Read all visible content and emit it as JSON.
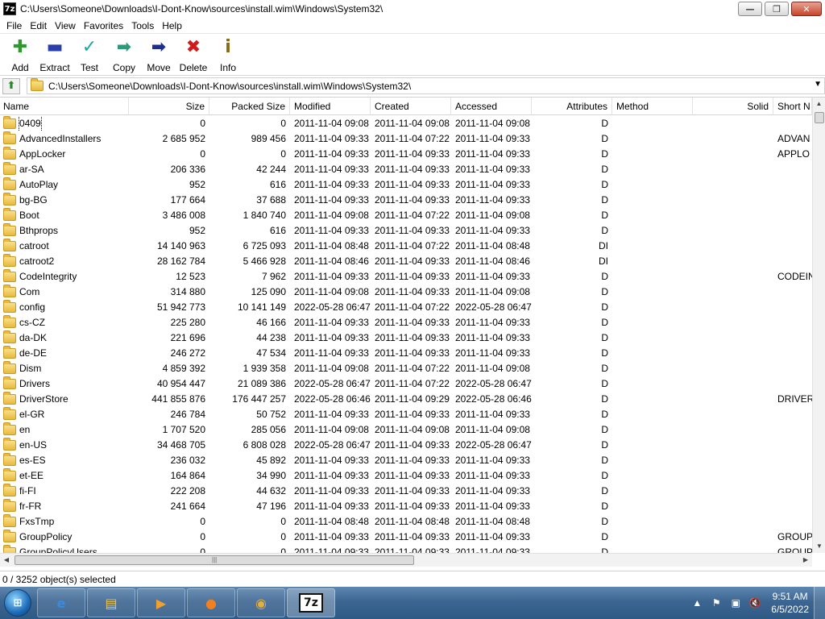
{
  "window": {
    "app_icon": "7z",
    "title": "C:\\Users\\Someone\\Downloads\\I-Dont-Know\\sources\\install.wim\\Windows\\System32\\",
    "min_label": "—",
    "max_label": "❐",
    "close_label": "✕"
  },
  "menu": [
    "File",
    "Edit",
    "View",
    "Favorites",
    "Tools",
    "Help"
  ],
  "toolbar": [
    {
      "label": "Add",
      "icon": "add-icon",
      "glyph": "✚",
      "color": "#2e9a2e"
    },
    {
      "label": "Extract",
      "icon": "extract-icon",
      "glyph": "▬",
      "color": "#2a3fa8"
    },
    {
      "label": "Test",
      "icon": "test-icon",
      "glyph": "✓",
      "color": "#1fa3a3"
    },
    {
      "label": "Copy",
      "icon": "copy-icon",
      "glyph": "➡",
      "color": "#2e9a7a"
    },
    {
      "label": "Move",
      "icon": "move-icon",
      "glyph": "➡",
      "color": "#1f2f8a"
    },
    {
      "label": "Delete",
      "icon": "delete-icon",
      "glyph": "✖",
      "color": "#d11a1a"
    },
    {
      "label": "Info",
      "icon": "info-icon",
      "glyph": "i",
      "color": "#8a6a10"
    }
  ],
  "address": {
    "up_glyph": "⬆",
    "path": "C:\\Users\\Someone\\Downloads\\I-Dont-Know\\sources\\install.wim\\Windows\\System32\\",
    "dropdown": "▼"
  },
  "columns": [
    "Name",
    "Size",
    "Packed Size",
    "Modified",
    "Created",
    "Accessed",
    "Attributes",
    "Method",
    "Solid",
    "Short N"
  ],
  "rows": [
    {
      "name": "0409",
      "size": "0",
      "packed": "0",
      "modified": "2011-11-04 09:08",
      "created": "2011-11-04 09:08",
      "accessed": "2011-11-04 09:08",
      "attr": "D",
      "short": "",
      "selected": true
    },
    {
      "name": "AdvancedInstallers",
      "size": "2 685 952",
      "packed": "989 456",
      "modified": "2011-11-04 09:33",
      "created": "2011-11-04 07:22",
      "accessed": "2011-11-04 09:33",
      "attr": "D",
      "short": "ADVAN"
    },
    {
      "name": "AppLocker",
      "size": "0",
      "packed": "0",
      "modified": "2011-11-04 09:33",
      "created": "2011-11-04 09:33",
      "accessed": "2011-11-04 09:33",
      "attr": "D",
      "short": "APPLO"
    },
    {
      "name": "ar-SA",
      "size": "206 336",
      "packed": "42 244",
      "modified": "2011-11-04 09:33",
      "created": "2011-11-04 09:33",
      "accessed": "2011-11-04 09:33",
      "attr": "D",
      "short": ""
    },
    {
      "name": "AutoPlay",
      "size": "952",
      "packed": "616",
      "modified": "2011-11-04 09:33",
      "created": "2011-11-04 09:33",
      "accessed": "2011-11-04 09:33",
      "attr": "D",
      "short": ""
    },
    {
      "name": "bg-BG",
      "size": "177 664",
      "packed": "37 688",
      "modified": "2011-11-04 09:33",
      "created": "2011-11-04 09:33",
      "accessed": "2011-11-04 09:33",
      "attr": "D",
      "short": ""
    },
    {
      "name": "Boot",
      "size": "3 486 008",
      "packed": "1 840 740",
      "modified": "2011-11-04 09:08",
      "created": "2011-11-04 07:22",
      "accessed": "2011-11-04 09:08",
      "attr": "D",
      "short": ""
    },
    {
      "name": "Bthprops",
      "size": "952",
      "packed": "616",
      "modified": "2011-11-04 09:33",
      "created": "2011-11-04 09:33",
      "accessed": "2011-11-04 09:33",
      "attr": "D",
      "short": ""
    },
    {
      "name": "catroot",
      "size": "14 140 963",
      "packed": "6 725 093",
      "modified": "2011-11-04 08:48",
      "created": "2011-11-04 07:22",
      "accessed": "2011-11-04 08:48",
      "attr": "DI",
      "short": ""
    },
    {
      "name": "catroot2",
      "size": "28 162 784",
      "packed": "5 466 928",
      "modified": "2011-11-04 08:46",
      "created": "2011-11-04 09:33",
      "accessed": "2011-11-04 08:46",
      "attr": "DI",
      "short": ""
    },
    {
      "name": "CodeIntegrity",
      "size": "12 523",
      "packed": "7 962",
      "modified": "2011-11-04 09:33",
      "created": "2011-11-04 09:33",
      "accessed": "2011-11-04 09:33",
      "attr": "D",
      "short": "CODEIN"
    },
    {
      "name": "Com",
      "size": "314 880",
      "packed": "125 090",
      "modified": "2011-11-04 09:08",
      "created": "2011-11-04 09:33",
      "accessed": "2011-11-04 09:08",
      "attr": "D",
      "short": ""
    },
    {
      "name": "config",
      "size": "51 942 773",
      "packed": "10 141 149",
      "modified": "2022-05-28 06:47",
      "created": "2011-11-04 07:22",
      "accessed": "2022-05-28 06:47",
      "attr": "D",
      "short": ""
    },
    {
      "name": "cs-CZ",
      "size": "225 280",
      "packed": "46 166",
      "modified": "2011-11-04 09:33",
      "created": "2011-11-04 09:33",
      "accessed": "2011-11-04 09:33",
      "attr": "D",
      "short": ""
    },
    {
      "name": "da-DK",
      "size": "221 696",
      "packed": "44 238",
      "modified": "2011-11-04 09:33",
      "created": "2011-11-04 09:33",
      "accessed": "2011-11-04 09:33",
      "attr": "D",
      "short": ""
    },
    {
      "name": "de-DE",
      "size": "246 272",
      "packed": "47 534",
      "modified": "2011-11-04 09:33",
      "created": "2011-11-04 09:33",
      "accessed": "2011-11-04 09:33",
      "attr": "D",
      "short": ""
    },
    {
      "name": "Dism",
      "size": "4 859 392",
      "packed": "1 939 358",
      "modified": "2011-11-04 09:08",
      "created": "2011-11-04 07:22",
      "accessed": "2011-11-04 09:08",
      "attr": "D",
      "short": ""
    },
    {
      "name": "Drivers",
      "size": "40 954 447",
      "packed": "21 089 386",
      "modified": "2022-05-28 06:47",
      "created": "2011-11-04 07:22",
      "accessed": "2022-05-28 06:47",
      "attr": "D",
      "short": ""
    },
    {
      "name": "DriverStore",
      "size": "441 855 876",
      "packed": "176 447 257",
      "modified": "2022-05-28 06:46",
      "created": "2011-11-04 09:29",
      "accessed": "2022-05-28 06:46",
      "attr": "D",
      "short": "DRIVER"
    },
    {
      "name": "el-GR",
      "size": "246 784",
      "packed": "50 752",
      "modified": "2011-11-04 09:33",
      "created": "2011-11-04 09:33",
      "accessed": "2011-11-04 09:33",
      "attr": "D",
      "short": ""
    },
    {
      "name": "en",
      "size": "1 707 520",
      "packed": "285 056",
      "modified": "2011-11-04 09:08",
      "created": "2011-11-04 09:08",
      "accessed": "2011-11-04 09:08",
      "attr": "D",
      "short": ""
    },
    {
      "name": "en-US",
      "size": "34 468 705",
      "packed": "6 808 028",
      "modified": "2022-05-28 06:47",
      "created": "2011-11-04 09:33",
      "accessed": "2022-05-28 06:47",
      "attr": "D",
      "short": ""
    },
    {
      "name": "es-ES",
      "size": "236 032",
      "packed": "45 892",
      "modified": "2011-11-04 09:33",
      "created": "2011-11-04 09:33",
      "accessed": "2011-11-04 09:33",
      "attr": "D",
      "short": ""
    },
    {
      "name": "et-EE",
      "size": "164 864",
      "packed": "34 990",
      "modified": "2011-11-04 09:33",
      "created": "2011-11-04 09:33",
      "accessed": "2011-11-04 09:33",
      "attr": "D",
      "short": ""
    },
    {
      "name": "fi-FI",
      "size": "222 208",
      "packed": "44 632",
      "modified": "2011-11-04 09:33",
      "created": "2011-11-04 09:33",
      "accessed": "2011-11-04 09:33",
      "attr": "D",
      "short": ""
    },
    {
      "name": "fr-FR",
      "size": "241 664",
      "packed": "47 196",
      "modified": "2011-11-04 09:33",
      "created": "2011-11-04 09:33",
      "accessed": "2011-11-04 09:33",
      "attr": "D",
      "short": ""
    },
    {
      "name": "FxsTmp",
      "size": "0",
      "packed": "0",
      "modified": "2011-11-04 08:48",
      "created": "2011-11-04 08:48",
      "accessed": "2011-11-04 08:48",
      "attr": "D",
      "short": ""
    },
    {
      "name": "GroupPolicy",
      "size": "0",
      "packed": "0",
      "modified": "2011-11-04 09:33",
      "created": "2011-11-04 09:33",
      "accessed": "2011-11-04 09:33",
      "attr": "D",
      "short": "GROUP"
    },
    {
      "name": "GroupPolicyUsers",
      "size": "0",
      "packed": "0",
      "modified": "2011-11-04 09:33",
      "created": "2011-11-04 09:33",
      "accessed": "2011-11-04 09:33",
      "attr": "D",
      "short": "GROUP"
    }
  ],
  "status": {
    "text": "0 / 3252 object(s) selected"
  },
  "taskbar": {
    "start_icon": "windows-start-icon",
    "items": [
      {
        "name": "internet-explorer",
        "glyph": "e",
        "color": "#3a8be0"
      },
      {
        "name": "file-explorer",
        "glyph": "▤",
        "color": "#e8c45a"
      },
      {
        "name": "media-player",
        "glyph": "▶",
        "color": "#f0a030"
      },
      {
        "name": "firefox",
        "glyph": "●",
        "color": "#f08020"
      },
      {
        "name": "setup-disc",
        "glyph": "◉",
        "color": "#e0b040"
      },
      {
        "name": "7-zip",
        "glyph": "7z",
        "color": "#111111",
        "active": true
      }
    ],
    "clock_time": "9:51 AM",
    "clock_date": "6/5/2022"
  }
}
